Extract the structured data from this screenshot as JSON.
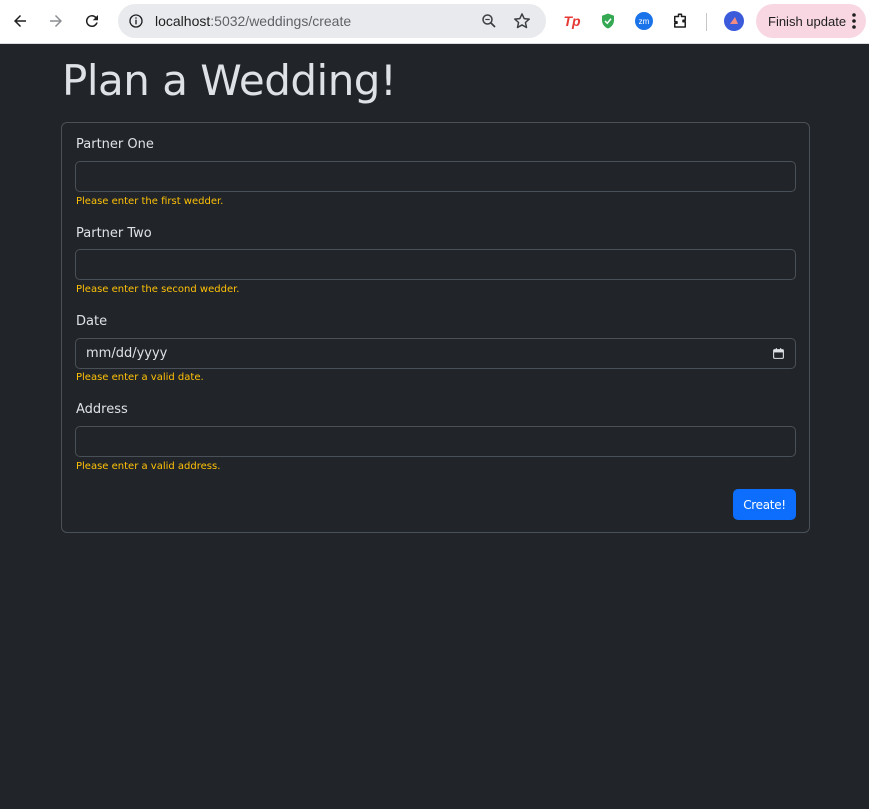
{
  "browser": {
    "url_host": "localhost",
    "url_path": ":5032/weddings/create",
    "finish_update_label": "Finish update",
    "extensions": [
      "tp-extension-icon",
      "shield-extension-icon",
      "zm-extension-icon",
      "puzzle-extensions-icon",
      "profile-avatar-icon"
    ],
    "zm_label": "zm",
    "tp_label": "Tp"
  },
  "page": {
    "title": "Plan a Wedding!"
  },
  "form": {
    "partner_one": {
      "label": "Partner One",
      "value": "",
      "error": "Please enter the first wedder."
    },
    "partner_two": {
      "label": "Partner Two",
      "value": "",
      "error": "Please enter the second wedder."
    },
    "date": {
      "label": "Date",
      "placeholder": "mm/dd/yyyy",
      "error": "Please enter a valid date."
    },
    "address": {
      "label": "Address",
      "value": "",
      "error": "Please enter a valid address."
    },
    "submit_label": "Create!"
  },
  "colors": {
    "page_bg": "#212529",
    "error_text": "#ffc107",
    "primary_button": "#0d6efd",
    "finish_update_bg": "#f8d7e3"
  }
}
